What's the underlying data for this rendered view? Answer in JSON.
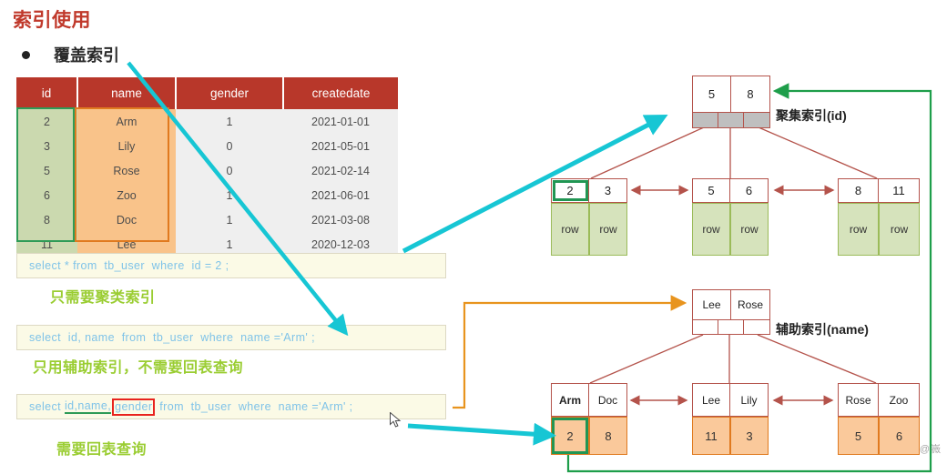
{
  "slide": {
    "title": "索引使用",
    "bullet_label": "覆盖索引",
    "watermark": "CSDN @嶶"
  },
  "table": {
    "headers": [
      "id",
      "name",
      "gender",
      "createdate"
    ],
    "rows": [
      [
        "2",
        "Arm",
        "1",
        "2021-01-01"
      ],
      [
        "3",
        "Lily",
        "0",
        "2021-05-01"
      ],
      [
        "5",
        "Rose",
        "0",
        "2021-02-14"
      ],
      [
        "6",
        "Zoo",
        "1",
        "2021-06-01"
      ],
      [
        "8",
        "Doc",
        "1",
        "2021-03-08"
      ],
      [
        "11",
        "Lee",
        "1",
        "2020-12-03"
      ]
    ],
    "highlight_id_color": "#2E9B57",
    "highlight_name_color": "#E07A1F",
    "header_color": "#B8372A",
    "id_cell_color": "#CBD9AF",
    "name_cell_color": "#F9C38A"
  },
  "sql": {
    "stmt1": "select * from  tb_user  where  id = 2 ;",
    "stmt2": "select  id, name  from  tb_user  where  name ='Arm' ;",
    "stmt3_pre": "select ",
    "stmt3_underlined": "id,name,",
    "stmt3_boxed": "gender",
    "stmt3_post": " from  tb_user  where  name ='Arm' ;"
  },
  "notes": {
    "note1": "只需要聚类索引",
    "note2": "只用辅助索引，不需要回表查询",
    "note3": "需要回表查询",
    "color": "#9ACD32"
  },
  "clustered_index": {
    "caption": "聚集索引(id)",
    "root_keys": [
      "5",
      "8"
    ],
    "leaves": [
      {
        "keys": [
          "2",
          "3"
        ],
        "rows": [
          "row",
          "row"
        ],
        "selected_key": "2"
      },
      {
        "keys": [
          "5",
          "6"
        ],
        "rows": [
          "row",
          "row"
        ],
        "selected_key": null
      },
      {
        "keys": [
          "8",
          "11"
        ],
        "rows": [
          "row",
          "row"
        ],
        "selected_key": null
      }
    ]
  },
  "secondary_index": {
    "caption": "辅助索引(name)",
    "root_keys": [
      "Lee",
      "Rose"
    ],
    "leaves": [
      {
        "keys": [
          "Arm",
          "Doc"
        ],
        "values": [
          "2",
          "8"
        ],
        "selected_value": "2"
      },
      {
        "keys": [
          "Lee",
          "Lily"
        ],
        "values": [
          "11",
          "3"
        ],
        "selected_value": null
      },
      {
        "keys": [
          "Rose",
          "Zoo"
        ],
        "values": [
          "5",
          "6"
        ],
        "selected_value": null
      }
    ]
  },
  "connectors": {
    "cyan_color": "#17C6D4",
    "orange_color": "#E8941E",
    "green_color": "#1E9E4A",
    "tree_color": "#B4534B"
  }
}
